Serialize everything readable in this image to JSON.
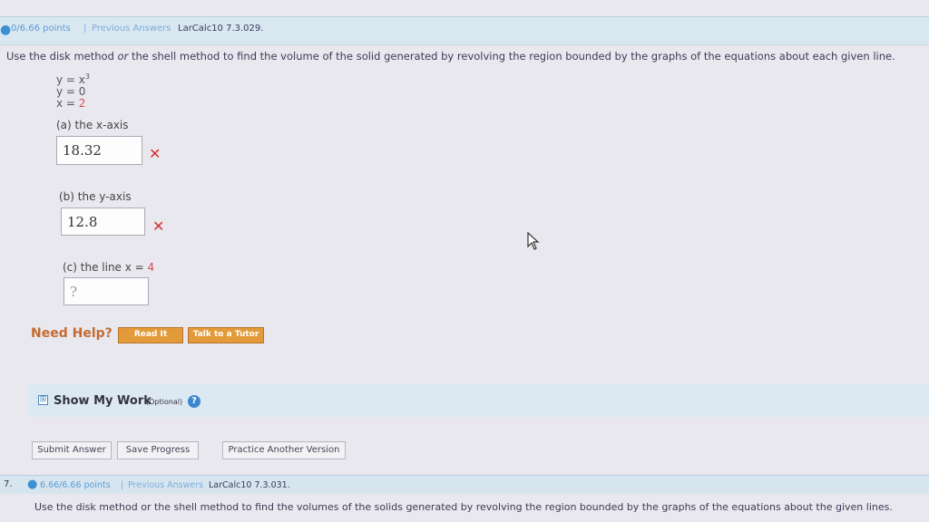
{
  "header": {
    "points": "0/6.66 points",
    "separator": "|",
    "previous_answers": "Previous Answers",
    "ref": "LarCalc10 7.3.029."
  },
  "question": {
    "part1": "Use the disk method ",
    "or": "or",
    "part2": " the shell method to find the volume of the solid generated by revolving the region bounded by the graphs of the equations about each given line."
  },
  "equations": {
    "eq1_left": "y = x",
    "eq1_exp": "3",
    "eq2": "y = 0",
    "eq3_left": "x = ",
    "eq3_val": "2"
  },
  "parts": {
    "a": {
      "label": "(a) the x-axis",
      "value": "18.32"
    },
    "b": {
      "label": "(b) the y-axis",
      "value": "12.8"
    },
    "c": {
      "label_prefix": "(c) the line x = ",
      "label_val": "4",
      "value": "?"
    }
  },
  "help": {
    "label": "Need Help?",
    "read_it": "Read It",
    "talk_tutor": "Talk to a Tutor"
  },
  "show_work": {
    "toggle": "⊞",
    "title": "Show My Work",
    "optional": "(Optional)",
    "help_icon": "?"
  },
  "actions": {
    "submit": "Submit Answer",
    "save": "Save Progress",
    "practice": "Practice Another Version"
  },
  "next": {
    "number": "7.",
    "points": "6.66/6.66 points",
    "separator": "|",
    "previous_answers": "Previous Answers",
    "ref": "LarCalc10 7.3.031.",
    "question": "Use the disk method or the shell method to find the volumes of the solids generated by revolving the region bounded by the graphs of the equations about the given lines."
  },
  "colors": {
    "wrong_mark": "#d9302c",
    "help_button": "#e39a39",
    "link_blue": "#5b9bd5"
  },
  "icons": {
    "incorrect": "x-mark-icon",
    "help": "question-circle-icon",
    "expand": "plus-box-icon",
    "cursor": "mouse-cursor-icon"
  }
}
